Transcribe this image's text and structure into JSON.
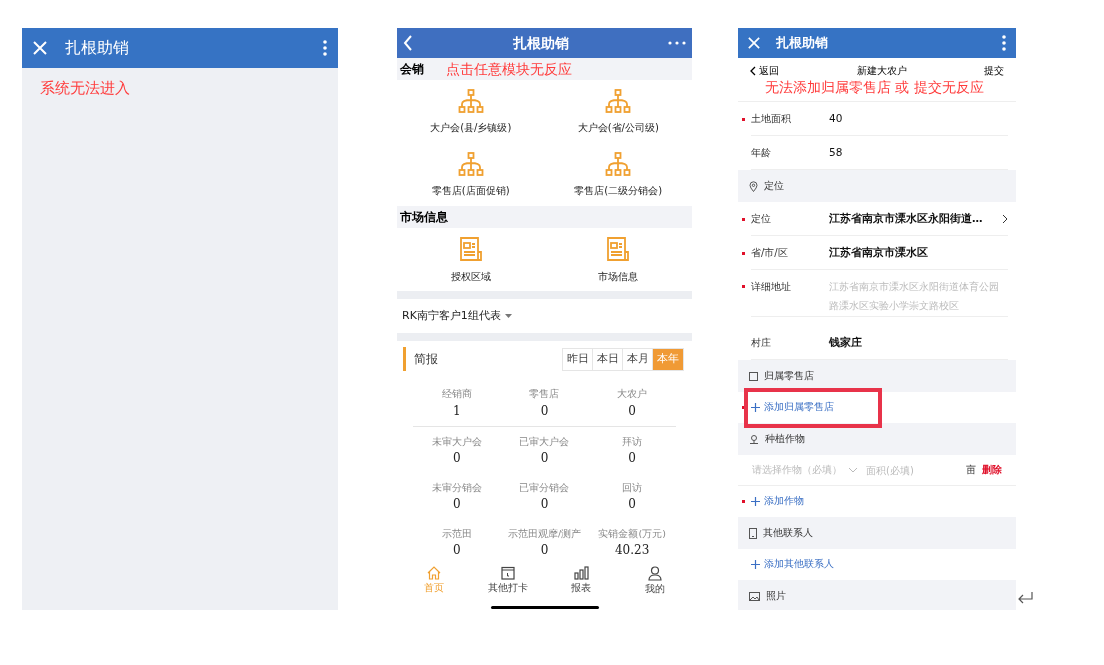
{
  "panel_1": {
    "title": "扎根助销",
    "annotation": "系统无法进入"
  },
  "panel_2": {
    "title": "扎根助销",
    "annotation": "点击任意模块无反应",
    "sections": [
      {
        "title": "会销",
        "kind": "hierarchy",
        "items": [
          "大户会(县/乡镇级)",
          "大户会(省/公司级)",
          "零售店(店面促销)",
          "零售店(二级分销会)"
        ]
      },
      {
        "title": "市场信息",
        "kind": "document",
        "items": [
          "授权区域",
          "市场信息"
        ]
      }
    ],
    "user_selector": "RK南宁客户1组代表",
    "report": {
      "title": "简报",
      "periods": [
        {
          "label": "昨日",
          "selected": false
        },
        {
          "label": "本日",
          "selected": false
        },
        {
          "label": "本月",
          "selected": false
        },
        {
          "label": "本年",
          "selected": true
        }
      ],
      "stats": [
        {
          "label": "经销商",
          "value": "1"
        },
        {
          "label": "零售店",
          "value": "0"
        },
        {
          "label": "大农户",
          "value": "0"
        },
        {
          "label": "未审大户会",
          "value": "0"
        },
        {
          "label": "已审大户会",
          "value": "0"
        },
        {
          "label": "拜访",
          "value": "0"
        },
        {
          "label": "未审分销会",
          "value": "0"
        },
        {
          "label": "已审分销会",
          "value": "0"
        },
        {
          "label": "回访",
          "value": "0"
        },
        {
          "label": "示范田",
          "value": "0"
        },
        {
          "label": "示范田观摩/测产",
          "value": "0"
        },
        {
          "label": "实销金额(万元)",
          "value": "40.23"
        }
      ]
    },
    "bottom_nav": [
      {
        "label": "首页",
        "selected": true
      },
      {
        "label": "其他打卡",
        "selected": false
      },
      {
        "label": "报表",
        "selected": false
      },
      {
        "label": "我的",
        "selected": false
      }
    ]
  },
  "panel_3": {
    "title": "扎根助销",
    "nav": {
      "back": "返回",
      "title": "新建大农户",
      "submit": "提交"
    },
    "annotation": "无法添加归属零售店 或 提交无反应",
    "rows": [
      {
        "kind": "field",
        "label": "土地面积",
        "value": "40",
        "required": true
      },
      {
        "kind": "field",
        "label": "年龄",
        "value": "58",
        "required": false
      },
      {
        "kind": "section",
        "label": "定位"
      },
      {
        "kind": "field",
        "label": "定位",
        "value": "江苏省南京市溧水区永阳街道…",
        "required": true,
        "bold": true,
        "chevron": true
      },
      {
        "kind": "field",
        "label": "省/市/区",
        "value": "江苏省南京市溧水区",
        "required": true,
        "bold": true
      },
      {
        "kind": "field",
        "label": "详细地址",
        "placeholder": "江苏省南京市溧水区永阳街道体育公园路溧水区实验小学崇文路校区",
        "required": true
      },
      {
        "kind": "field",
        "label": "村庄",
        "value": "钱家庄",
        "required": false,
        "bold": true
      },
      {
        "kind": "section",
        "label": "归属零售店"
      },
      {
        "kind": "add",
        "label": "添加归属零售店",
        "required": true
      },
      {
        "kind": "section",
        "label": "种植作物"
      },
      {
        "kind": "crop",
        "crop_placeholder": "请选择作物（必填）",
        "area_placeholder": "面积(必填)",
        "unit": "亩",
        "delete": "删除"
      },
      {
        "kind": "add",
        "label": "添加作物",
        "required": true
      },
      {
        "kind": "section",
        "label": "其他联系人"
      },
      {
        "kind": "add",
        "label": "添加其他联系人",
        "required": false
      },
      {
        "kind": "section",
        "label": "照片"
      }
    ]
  }
}
